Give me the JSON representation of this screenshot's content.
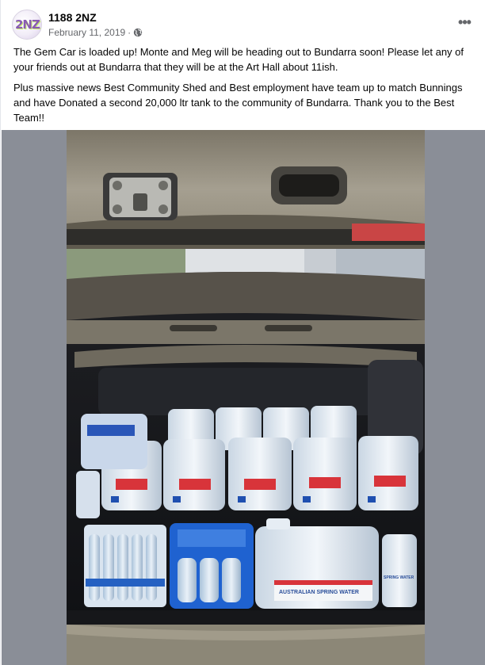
{
  "post": {
    "page_name": "1188 2NZ",
    "avatar_text": "2NZ",
    "date": "February 11, 2019",
    "separator": "·",
    "privacy_icon": "globe-icon",
    "more_icon": "more-horizontal-icon",
    "more_label": "•••",
    "paragraphs": [
      "The Gem Car is loaded up! Monte and Meg will be heading out to Bundarra soon! Please let any of your friends out at Bundarra that they will be at the Art Hall about 11ish.",
      "Plus massive news Best Community Shed and Best employment have team up to match Bunnings and have Donated a second 20,000 ltr tank to the community of Bundarra. Thank you to the Best Team!!"
    ]
  },
  "photo": {
    "label_large": "AUSTRALIAN SPRING WATER",
    "label_small": "SPRING WATER",
    "background_color": "#8a8e97"
  },
  "colors": {
    "text_primary": "#050505",
    "text_secondary": "#65676b",
    "accent_avatar": "#8a5bb3"
  }
}
